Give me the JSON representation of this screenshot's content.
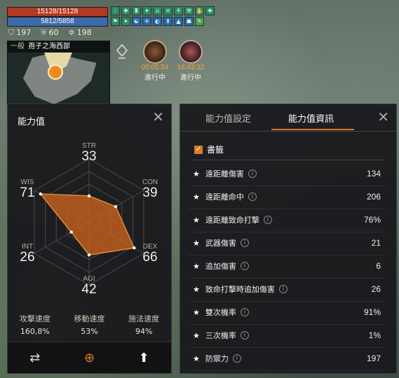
{
  "hud": {
    "hp": "15128/15128",
    "mp": "5812/5858",
    "defense": "197",
    "shield": "60",
    "other": "198",
    "buff_icons": [
      "buff",
      "buff",
      "buff",
      "buff",
      "buff",
      "buff",
      "buff",
      "buff",
      "buff",
      "buff",
      "buff",
      "buff",
      "buff",
      "buff",
      "buff",
      "buff",
      "buff",
      "buff",
      "buff"
    ]
  },
  "minimap": {
    "category": "一般",
    "location": "孢子之海西部"
  },
  "quests": [
    {
      "time": "00:05:54",
      "state": "進行中"
    },
    {
      "time": "16:43:32",
      "state": "進行中"
    }
  ],
  "left_panel": {
    "title": "能力值",
    "stats": {
      "str": {
        "label": "STR",
        "value": "33"
      },
      "con": {
        "label": "CON",
        "value": "39"
      },
      "dex": {
        "label": "DEX",
        "value": "66"
      },
      "agi": {
        "label": "AGI",
        "value": "42"
      },
      "int": {
        "label": "INT",
        "value": "26"
      },
      "wis": {
        "label": "WIS",
        "value": "71"
      }
    },
    "radar_levels": {
      "str": 33,
      "con": 39,
      "dex": 66,
      "agi": 42,
      "int": 26,
      "wis": 71,
      "max": 80
    },
    "speeds": [
      {
        "label": "攻擊速度",
        "value": "160,8%"
      },
      {
        "label": "移動速度",
        "value": "53%"
      },
      {
        "label": "施法速度",
        "value": "94%"
      }
    ]
  },
  "right_panel": {
    "tabs": [
      "能力值設定",
      "能力值資訊"
    ],
    "bookmark": "書籤",
    "rows": [
      {
        "label": "遠距離傷害",
        "value": "134"
      },
      {
        "label": "遠距離命中",
        "value": "206"
      },
      {
        "label": "遠距離致命打擊",
        "value": "76%"
      },
      {
        "label": "武器傷害",
        "value": "21"
      },
      {
        "label": "追加傷害",
        "value": "6"
      },
      {
        "label": "致命打擊時追加傷害",
        "value": "26"
      },
      {
        "label": "雙次機率",
        "value": "91%"
      },
      {
        "label": "三次機率",
        "value": "1%"
      },
      {
        "label": "防禦力",
        "value": "197"
      }
    ]
  },
  "colors": {
    "accent": "#d07a2a",
    "radar_fill": "#c8621d"
  }
}
